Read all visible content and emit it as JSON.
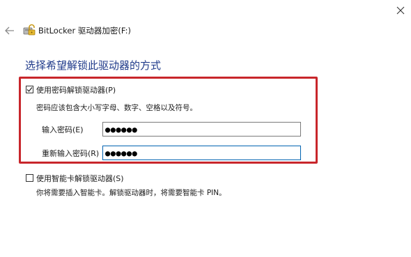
{
  "window": {
    "title": "BitLocker 驱动器加密(F:)"
  },
  "page": {
    "heading": "选择希望解锁此驱动器的方式"
  },
  "password_option": {
    "label": "使用密码解锁驱动器(P)",
    "checked": true,
    "hint": "密码应该包含大小写字母、数字、空格以及符号。",
    "enter_label": "输入密码(E)",
    "enter_value": "●●●●●●",
    "reenter_label": "重新输入密码(R)",
    "reenter_value": "●●●●●●"
  },
  "smartcard_option": {
    "label": "使用智能卡解锁驱动器(S)",
    "checked": false,
    "hint": "你将需要插入智能卡。解锁驱动器时，将需要智能卡 PIN。"
  },
  "colors": {
    "heading": "#1f3a8a",
    "highlight": "#c8262b",
    "focus_border": "#0063b1"
  },
  "icons": {
    "back": "back-arrow-icon",
    "app": "bitlocker-icon",
    "close": "close-icon",
    "check": "checkmark-icon"
  }
}
